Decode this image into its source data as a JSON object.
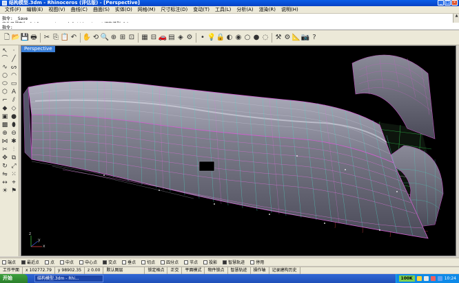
{
  "window": {
    "title": "结构模型.3dm - Rhinoceros (评估版) - [Perspective]",
    "min": "_",
    "max": "□",
    "close": "×"
  },
  "menu": [
    "文件(F)",
    "编辑(E)",
    "视图(V)",
    "曲线(C)",
    "曲面(S)",
    "实体(O)",
    "网格(M)",
    "尺寸标注(D)",
    "变动(T)",
    "工具(L)",
    "分析(A)",
    "渲染(R)",
    "说明(H)"
  ],
  "command": {
    "history_1": "指令: _Save",
    "history_2": "文件已储存为 C:\\Documents and Settings\\...\\结构模型.3dm",
    "prompt": "指令:"
  },
  "viewport": {
    "label": "Perspective",
    "axes": {
      "x": "x",
      "y": "y",
      "z": "z"
    }
  },
  "osnaps": [
    {
      "label": "端点",
      "on": false
    },
    {
      "label": "最近点",
      "on": true
    },
    {
      "label": "点",
      "on": false
    },
    {
      "label": "中点",
      "on": false
    },
    {
      "label": "中心点",
      "on": false
    },
    {
      "label": "交点",
      "on": true
    },
    {
      "label": "垂点",
      "on": false
    },
    {
      "label": "切点",
      "on": false
    },
    {
      "label": "四分点",
      "on": false
    },
    {
      "label": "节点",
      "on": false
    },
    {
      "label": "投影",
      "on": false
    },
    {
      "label": "智慧轨迹",
      "on": true
    },
    {
      "label": "停用",
      "on": false
    }
  ],
  "status": {
    "cplane": "工作平面",
    "x": "x 102772.79",
    "y": "y 98902.35",
    "z": "z 0.00",
    "layer": "默认图层",
    "snap": "锁定格点",
    "ortho": "正交",
    "planar": "平面模式",
    "osnap": "物件锁点",
    "track": "智慧轨迹",
    "gumball": "操作轴",
    "history": "记录建构历史"
  },
  "taskbar": {
    "start": "开始",
    "task": "结构模型.3dm - Rhi...",
    "ok": "100K",
    "time": "10:24"
  }
}
